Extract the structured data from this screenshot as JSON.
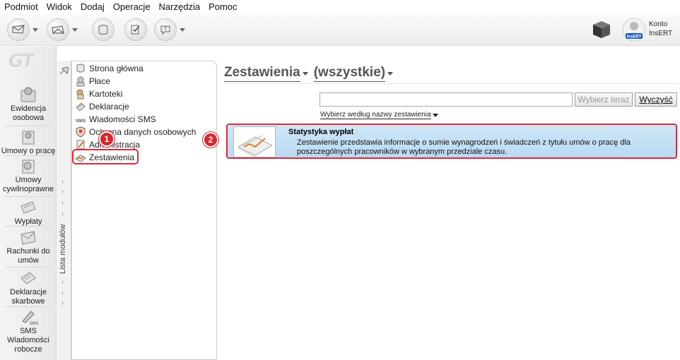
{
  "menu": [
    "Podmiot",
    "Widok",
    "Dodaj",
    "Operacje",
    "Narzędzia",
    "Pomoc"
  ],
  "account": {
    "line1": "Konto",
    "line2": "InsERT",
    "avatar_caption": "InsERT"
  },
  "logo_text": "GT",
  "leftnav": [
    {
      "line1": "Ewidencja",
      "line2": "osobowa",
      "icon": "person-file-icon"
    },
    {
      "line1": "Umowy o pracę",
      "line2": "",
      "icon": "contract-icon"
    },
    {
      "line1": "Umowy",
      "line2": "cywilnoprawne",
      "icon": "civil-contract-icon"
    },
    {
      "line1": "Wypłaty",
      "line2": "",
      "icon": "payout-icon"
    },
    {
      "line1": "Rachunki do",
      "line2": "umów",
      "icon": "invoice-icon"
    },
    {
      "line1": "Deklaracje",
      "line2": "skarbowe",
      "icon": "tax-declaration-icon"
    },
    {
      "line1": "SMS",
      "line2": "Wiadomości",
      "line3": "robocze",
      "icon": "sms-icon"
    }
  ],
  "strip_label": "Lista modułów",
  "modules": [
    {
      "label": "Strona główna",
      "icon": "home-page-icon"
    },
    {
      "label": "Płace",
      "icon": "payroll-icon"
    },
    {
      "label": "Kartoteki",
      "icon": "records-icon"
    },
    {
      "label": "Deklaracje",
      "icon": "declarations-icon"
    },
    {
      "label": "Wiadomości SMS",
      "icon": "sms-icon",
      "icon_text": "SMS"
    },
    {
      "label": "Ochrona danych osobowych",
      "icon": "data-protection-icon"
    },
    {
      "label": "Administracja",
      "icon": "administration-icon"
    },
    {
      "label": "Zestawienia",
      "icon": "reports-icon"
    }
  ],
  "badges": {
    "one": "1",
    "two": "2"
  },
  "main": {
    "title": "Zestawienia",
    "filter": "(wszystkie)",
    "search_value": "",
    "search_placeholder": "",
    "choose_button": "Wybierz teraz",
    "clear_button": "Wyczyść",
    "select_by": "Wybierz według nazwy zestawienia",
    "results": [
      {
        "title": "Statystyka wypłat",
        "description": "Zestawienie przedstawia informacje o sumie wynagrodzeń i świadczeń z tytułu umów o pracę dla poszczególnych pracowników w wybranym przedziale czasu."
      }
    ]
  },
  "colors": {
    "accent": "#e0283a",
    "selection": "#bcdcf4",
    "title": "#555555"
  }
}
